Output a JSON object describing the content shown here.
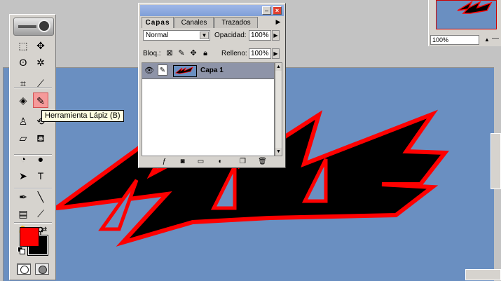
{
  "tooltip": "Herramienta Lápiz (B)",
  "layers_palette": {
    "tabs": [
      "Capas",
      "Canales",
      "Trazados"
    ],
    "blend_mode": "Normal",
    "opacity_label": "Opacidad:",
    "opacity_value": "100%",
    "lock_label": "Bloq.:",
    "fill_label": "Relleno:",
    "fill_value": "100%",
    "layer_name": "Capa 1"
  },
  "navigator": {
    "zoom": "100%"
  },
  "colors": {
    "foreground": "#ff0000",
    "background": "#000000",
    "canvas": "#6a8fc1",
    "stroke": "#ff0000"
  },
  "tools": [
    {
      "name": "marquee-tool-icon",
      "glyph": "⬚"
    },
    {
      "name": "move-tool-icon",
      "glyph": "✥"
    },
    {
      "name": "lasso-tool-icon",
      "glyph": "ʘ"
    },
    {
      "name": "magic-wand-tool-icon",
      "glyph": "✲"
    },
    {
      "name": "crop-tool-icon",
      "glyph": "⌗"
    },
    {
      "name": "slice-tool-icon",
      "glyph": "⟋"
    },
    {
      "name": "healing-brush-tool-icon",
      "glyph": "◈"
    },
    {
      "name": "pencil-tool-icon",
      "glyph": "✎"
    },
    {
      "name": "clone-stamp-tool-icon",
      "glyph": "♙"
    },
    {
      "name": "history-brush-tool-icon",
      "glyph": "⟲"
    },
    {
      "name": "eraser-tool-icon",
      "glyph": "▱"
    },
    {
      "name": "paint-bucket-tool-icon",
      "glyph": "⛾"
    },
    {
      "name": "blur-tool-icon",
      "glyph": "◔"
    },
    {
      "name": "dodge-tool-icon",
      "glyph": "●"
    },
    {
      "name": "path-selection-tool-icon",
      "glyph": "➤"
    },
    {
      "name": "type-tool-icon",
      "glyph": "T"
    },
    {
      "name": "pen-tool-icon",
      "glyph": "✒"
    },
    {
      "name": "line-tool-icon",
      "glyph": "╲"
    },
    {
      "name": "notes-tool-icon",
      "glyph": "▤"
    },
    {
      "name": "eyedropper-tool-icon",
      "glyph": "⟋"
    },
    {
      "name": "hand-tool-icon",
      "glyph": "✋"
    },
    {
      "name": "zoom-tool-icon",
      "glyph": "⚲"
    }
  ]
}
